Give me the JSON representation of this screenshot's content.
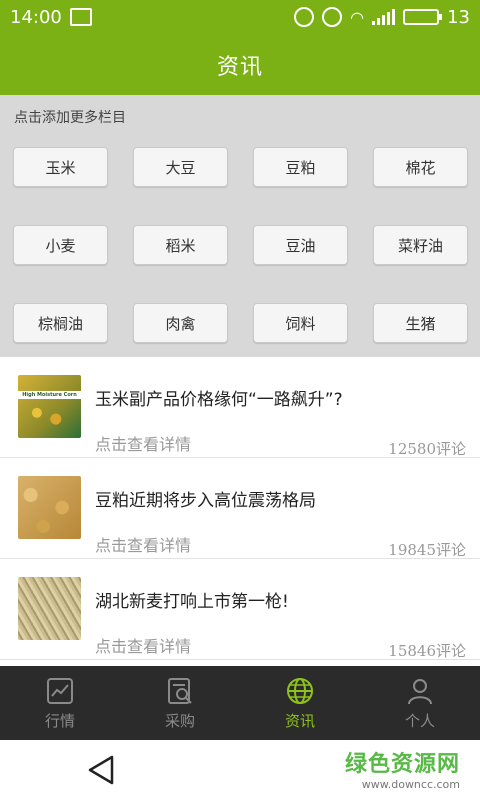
{
  "status_bar": {
    "time": "14:00",
    "battery": "13"
  },
  "header": {
    "title": "资讯"
  },
  "categories": {
    "hint": "点击添加更多栏目",
    "items": [
      "玉米",
      "大豆",
      "豆粕",
      "棉花",
      "小麦",
      "稻米",
      "豆油",
      "菜籽油",
      "棕榈油",
      "肉禽",
      "饲料",
      "生猪"
    ]
  },
  "news": [
    {
      "title": "玉米副产品价格缘何“一路飙升”?",
      "subtitle": "点击查看详情",
      "comments": "12580评论",
      "thumb_label": "High Moisture Corn"
    },
    {
      "title": "豆粕近期将步入高位震荡格局",
      "subtitle": "点击查看详情",
      "comments": "19845评论"
    },
    {
      "title": "湖北新麦打响上市第一枪!",
      "subtitle": "点击查看详情",
      "comments": "15846评论"
    }
  ],
  "tabs": [
    {
      "label": "行情",
      "icon": "chart-icon"
    },
    {
      "label": "采购",
      "icon": "purchase-icon"
    },
    {
      "label": "资讯",
      "icon": "globe-icon"
    },
    {
      "label": "个人",
      "icon": "person-icon"
    }
  ],
  "watermark": {
    "name": "绿色资源网",
    "url": "www.downcc.com"
  },
  "colors": {
    "brand": "#7bb115",
    "tab_active": "#8cc21a",
    "tabbar_bg": "#2b2b2b"
  }
}
